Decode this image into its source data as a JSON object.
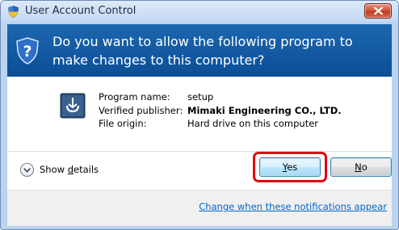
{
  "window": {
    "title": "User Account Control",
    "close_icon": "close-x-icon"
  },
  "header": {
    "question": "Do you want to allow the following program to make changes to this computer?",
    "icon": "uac-shield-question-icon"
  },
  "program": {
    "icon": "setup-program-icon",
    "labels": {
      "name": "Program name:",
      "publisher": "Verified publisher:",
      "origin": "File origin:"
    },
    "values": {
      "name": "setup",
      "publisher": "Mimaki Engineering CO., LTD.",
      "origin": "Hard drive on this computer"
    }
  },
  "details": {
    "label_prefix": "Show ",
    "label_accel": "d",
    "label_suffix": "etails",
    "icon": "chevron-down-icon"
  },
  "buttons": {
    "yes_accel": "Y",
    "yes_rest": "es",
    "no_accel": "N",
    "no_rest": "o"
  },
  "footer": {
    "link": "Change when these notifications appear"
  },
  "colors": {
    "header_band": "#0b4e95",
    "highlight": "#e0000f",
    "link": "#0066cc"
  }
}
